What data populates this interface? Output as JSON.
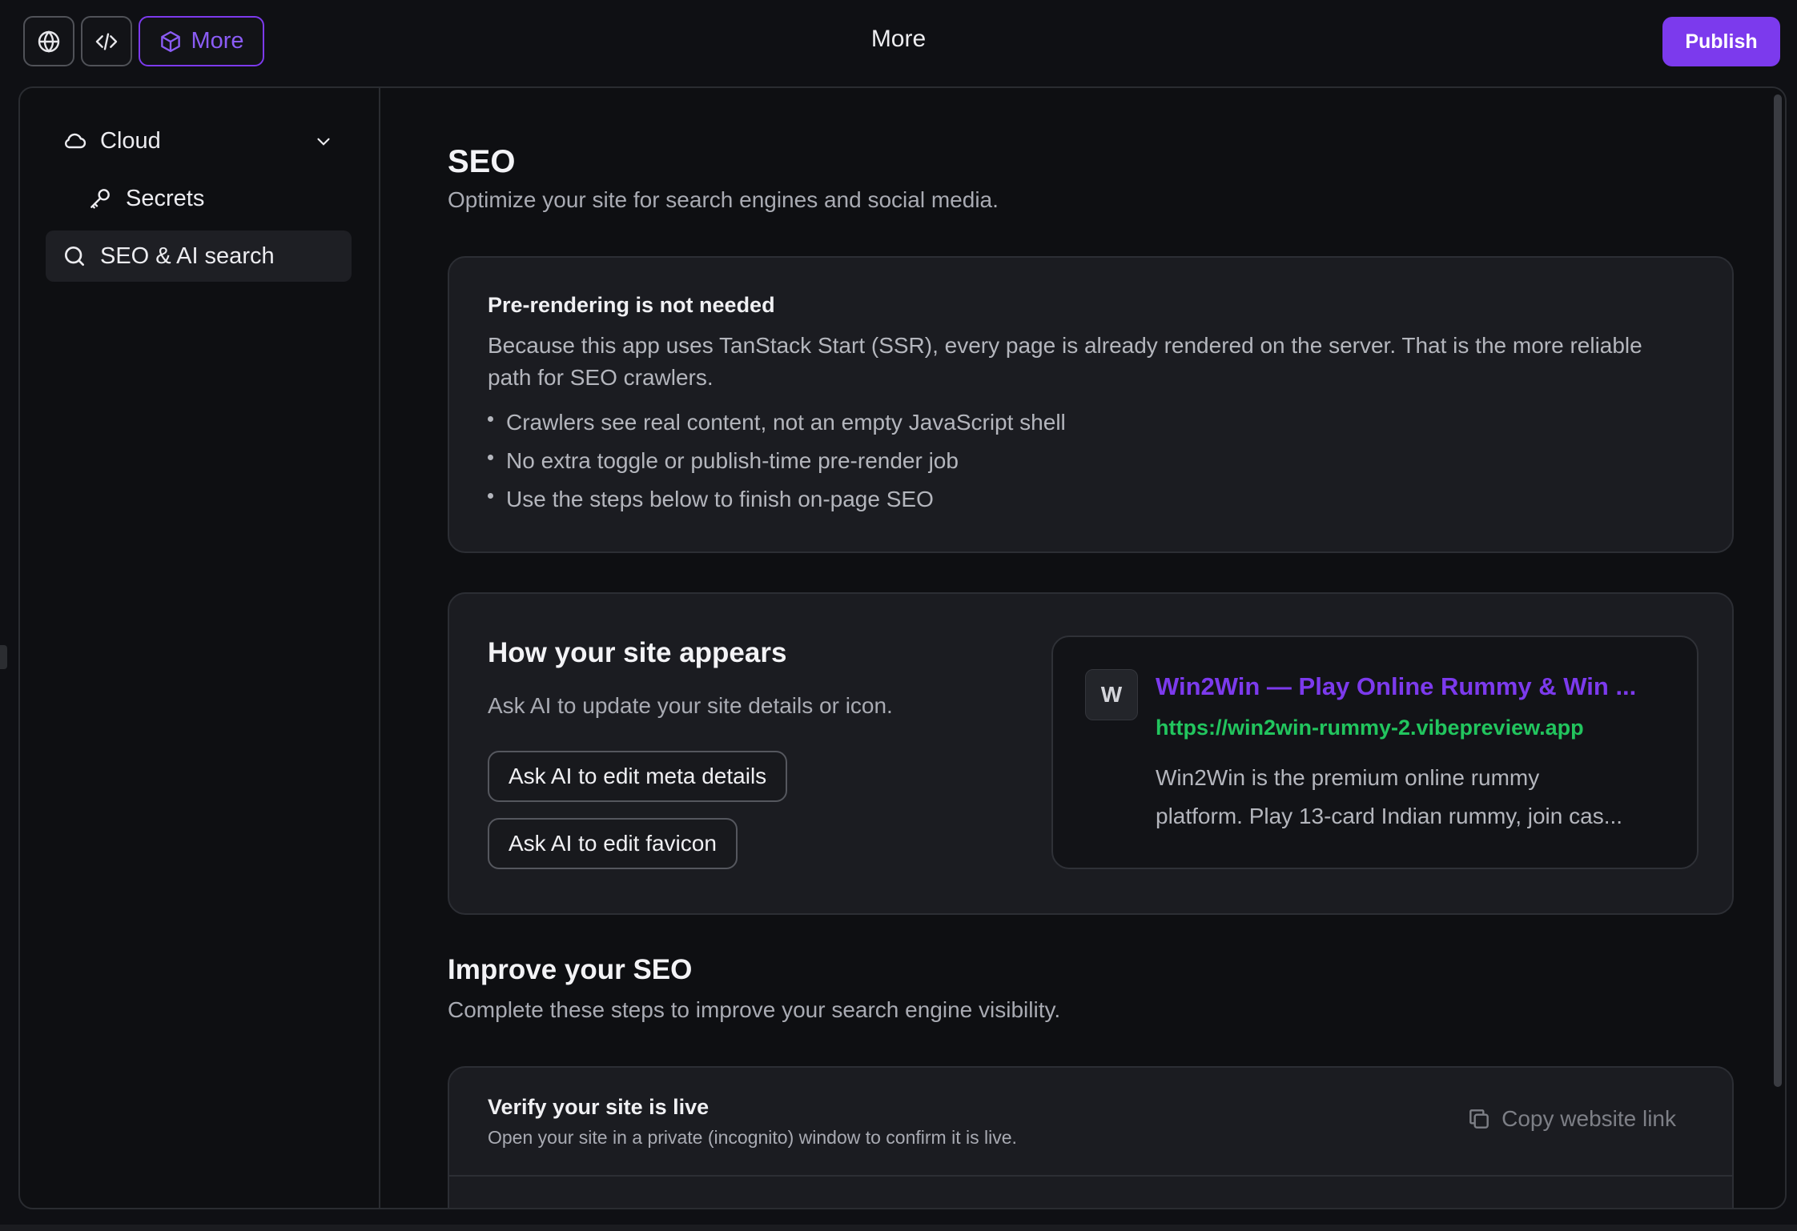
{
  "header": {
    "title": "More",
    "more_label": "More",
    "publish_label": "Publish"
  },
  "sidebar": {
    "items": [
      {
        "label": "Cloud",
        "icon": "cloud-icon"
      },
      {
        "label": "Secrets",
        "icon": "key-icon"
      },
      {
        "label": "SEO & AI search",
        "icon": "search-icon"
      }
    ]
  },
  "seo": {
    "title": "SEO",
    "subtitle": "Optimize your site for search engines and social media.",
    "prerender": {
      "title": "Pre-rendering is not needed",
      "description": "Because this app uses TanStack Start (SSR), every page is already rendered on the server. That is the more reliable path for SEO crawlers.",
      "bullets": [
        "Crawlers see real content, not an empty JavaScript shell",
        "No extra toggle or publish-time pre-render job",
        "Use the steps below to finish on-page SEO"
      ]
    },
    "appearance": {
      "title": "How your site appears",
      "subtitle": "Ask AI to update your site details or icon.",
      "meta_button": "Ask AI to edit meta details",
      "favicon_button": "Ask AI to edit favicon",
      "preview": {
        "favicon_letter": "W",
        "title": "Win2Win — Play Online Rummy & Win ...",
        "url": "https://win2win-rummy-2.vibepreview.app",
        "description_line1": "Win2Win is the premium online rummy",
        "description_line2": "platform. Play 13-card Indian rummy, join cas..."
      }
    },
    "improve": {
      "title": "Improve your SEO",
      "subtitle": "Complete these steps to improve your search engine visibility.",
      "steps": [
        {
          "title": "Verify your site is live",
          "description": "Open your site in a private (incognito) window to confirm it is live.",
          "action": "Copy website link"
        }
      ]
    }
  },
  "colors": {
    "accent": "#7c3aed",
    "url_green": "#22c55e",
    "background": "#0f1014",
    "card": "#1b1c21"
  }
}
